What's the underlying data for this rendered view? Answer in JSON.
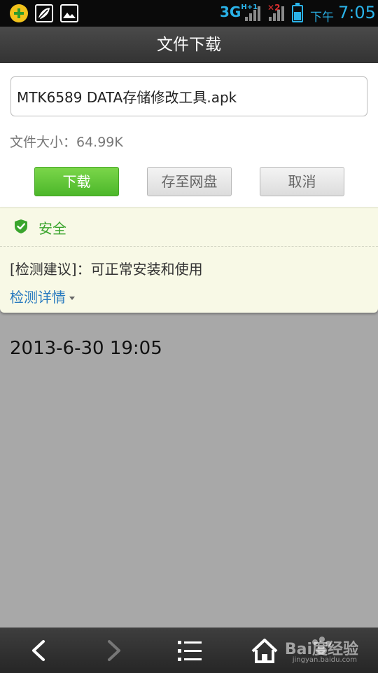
{
  "status_bar": {
    "network_type": "3G",
    "network_sub": "H+1",
    "sim2_label": "2",
    "ampm": "下午",
    "time": "7:05",
    "accent_color": "#2ab2e8"
  },
  "titlebar": {
    "title": "文件下载"
  },
  "download_dialog": {
    "filename_value": "MTK6589 DATA存储修改工具.apk",
    "file_size_text": "文件大小：64.99K",
    "buttons": {
      "download": "下载",
      "save_to_cloud": "存至网盘",
      "cancel": "取消"
    }
  },
  "security_panel": {
    "status_label": "安全",
    "status_color": "#3aa52d",
    "advice_text": "[检测建议]：可正常安装和使用",
    "details_link": "检测详情"
  },
  "background_content": {
    "datetime_text": "2013-6-30 19:05"
  },
  "bottom_nav": {
    "watermark": "Bai度经验",
    "watermark_url": "jingyan.baidu.com"
  },
  "icons": [
    "app-logo-icon",
    "leaf-icon",
    "image-icon",
    "signal-icon",
    "battery-icon",
    "shield-check-icon",
    "back-icon",
    "forward-icon",
    "menu-icon",
    "home-icon",
    "paw-icon"
  ]
}
